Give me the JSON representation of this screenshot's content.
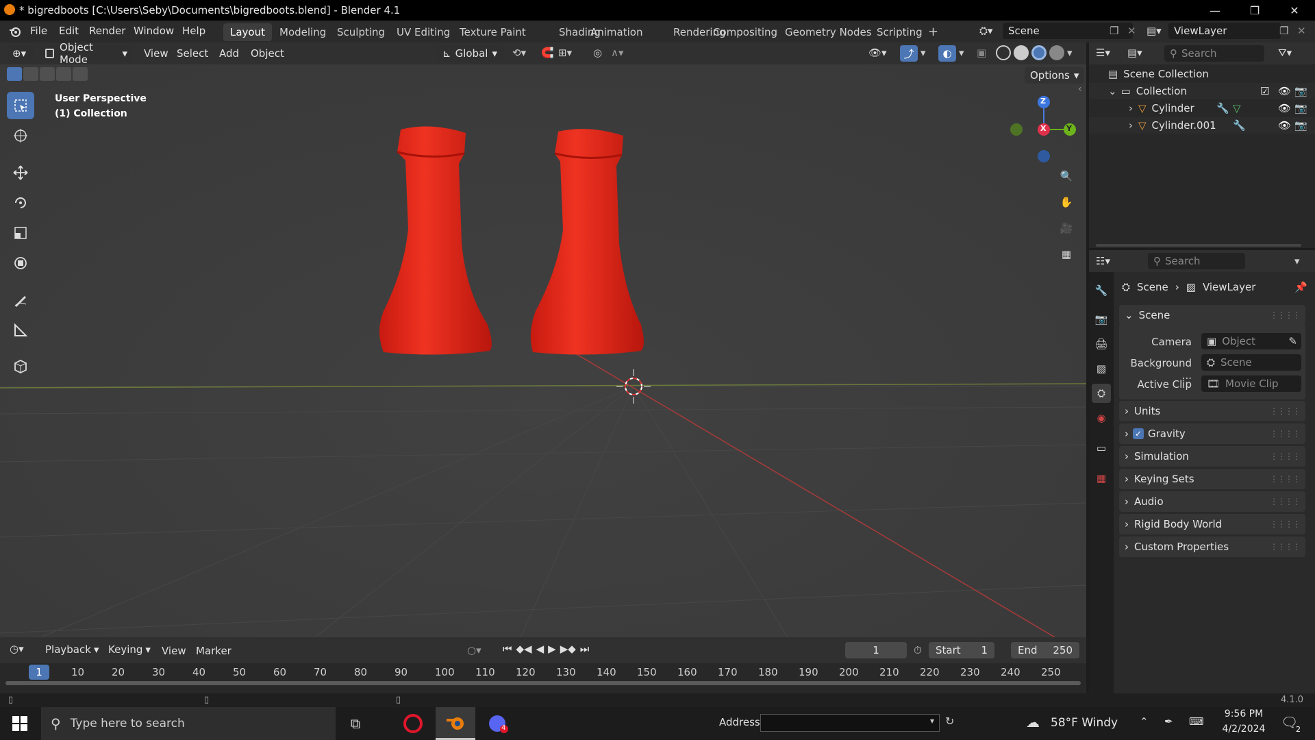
{
  "titlebar": {
    "title": "* bigredboots [C:\\Users\\Seby\\Documents\\bigredboots.blend] - Blender 4.1",
    "controls": [
      "—",
      "❐",
      "✕"
    ]
  },
  "menu": [
    "File",
    "Edit",
    "Render",
    "Window",
    "Help"
  ],
  "workspaces": [
    "Layout",
    "Modeling",
    "Sculpting",
    "UV Editing",
    "Texture Paint",
    "Shading",
    "Animation",
    "Rendering",
    "Compositing",
    "Geometry Nodes",
    "Scripting"
  ],
  "active_workspace": "Layout",
  "scene_field": "Scene",
  "viewlayer_field": "ViewLayer",
  "viewport_header": {
    "mode": "Object Mode",
    "menus": [
      "View",
      "Select",
      "Add",
      "Object"
    ],
    "transform_orientation": "Global",
    "options_label": "Options"
  },
  "viewport": {
    "perspective": "User Perspective",
    "collection": "(1) Collection",
    "gizmo_axes": [
      "Z",
      "X",
      "Y"
    ],
    "object_color": "#e5271b"
  },
  "timeline": {
    "menus": [
      "Playback",
      "Keying",
      "View",
      "Marker"
    ],
    "current_frame": "1",
    "start_label": "Start",
    "start_value": "1",
    "end_label": "End",
    "end_value": "250",
    "ticks": [
      "1",
      "10",
      "20",
      "30",
      "40",
      "50",
      "60",
      "70",
      "80",
      "90",
      "100",
      "110",
      "120",
      "130",
      "140",
      "150",
      "160",
      "170",
      "180",
      "190",
      "200",
      "210",
      "220",
      "230",
      "240",
      "250"
    ]
  },
  "status": {
    "version": "4.1.0"
  },
  "outliner": {
    "search_placeholder": "Search",
    "scene_collection": "Scene Collection",
    "collection": "Collection",
    "objects": [
      "Cylinder",
      "Cylinder.001"
    ]
  },
  "properties": {
    "search_placeholder": "Search",
    "breadcrumb": [
      "Scene",
      "ViewLayer"
    ],
    "scene_panel": "Scene",
    "camera_label": "Camera",
    "camera_placeholder": "Object",
    "background_label": "Background ...",
    "background_placeholder": "Scene",
    "active_clip_label": "Active Clip",
    "active_clip_placeholder": "Movie Clip",
    "panels": [
      "Units",
      "Gravity",
      "Simulation",
      "Keying Sets",
      "Audio",
      "Rigid Body World",
      "Custom Properties"
    ],
    "gravity_checked": true
  },
  "taskbar": {
    "search_placeholder": "Type here to search",
    "address_label": "Address",
    "weather": "58°F  Windy",
    "time": "9:56 PM",
    "date": "4/2/2024",
    "notification_count": "2",
    "app_badge": "4"
  }
}
